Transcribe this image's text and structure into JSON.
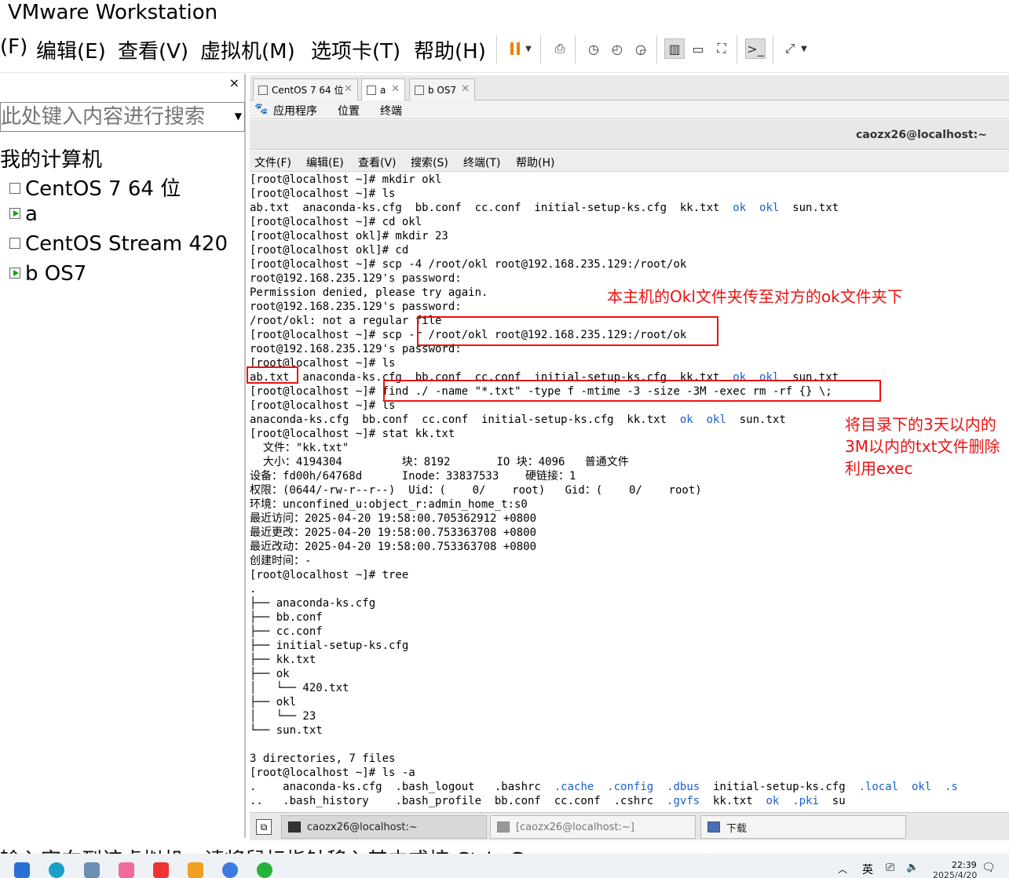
{
  "app_title": "VMware Workstation",
  "menu": [
    "(F)",
    "编辑(E)",
    "查看(V)",
    "虚拟机(M)",
    "选项卡(T)",
    "帮助(H)"
  ],
  "library": {
    "close": "×",
    "search_placeholder": "此处键入内容进行搜索",
    "root": "我的计算机",
    "vms": [
      "CentOS 7 64 位",
      "a",
      "CentOS Stream 420",
      "b OS7"
    ]
  },
  "vm_tabs": [
    {
      "label": "CentOS 7 64 位",
      "active": false
    },
    {
      "label": "a",
      "active": true
    },
    {
      "label": "b OS7",
      "active": false
    }
  ],
  "gnome_panel": [
    "应用程序",
    "位置",
    "终端"
  ],
  "terminal_window_title": "caozx26@localhost:~",
  "terminal_menu": [
    "文件(F)",
    "编辑(E)",
    "查看(V)",
    "搜索(S)",
    "终端(T)",
    "帮助(H)"
  ],
  "terminal_lines": [
    "[root@localhost ~]# mkdir okl",
    "[root@localhost ~]# ls",
    "ab.txt  anaconda-ks.cfg  bb.conf  cc.conf  initial-setup-ks.cfg  kk.txt  ",
    "[root@localhost ~]# cd okl",
    "[root@localhost okl]# mkdir 23",
    "[root@localhost okl]# cd",
    "[root@localhost ~]# scp -4 /root/okl root@192.168.235.129:/root/ok",
    "root@192.168.235.129's password:",
    "Permission denied, please try again.",
    "root@192.168.235.129's password:",
    "/root/okl: not a regular file",
    "[root@localhost ~]# scp -r /root/okl root@192.168.235.129:/root/ok",
    "root@192.168.235.129's password:",
    "[root@localhost ~]# ls",
    "ab.txt  anaconda-ks.cfg  bb.conf  cc.conf  initial-setup-ks.cfg  kk.txt  ",
    "[root@localhost ~]# find ./ -name \"*.txt\" -type f -mtime -3 -size -3M -exec rm -rf {} \\;",
    "[root@localhost ~]# ls",
    "anaconda-ks.cfg  bb.conf  cc.conf  initial-setup-ks.cfg  kk.txt  ",
    "[root@localhost ~]# stat kk.txt",
    "  文件：\"kk.txt\"",
    "  大小：4194304         块：8192       IO 块：4096   普通文件",
    "设备：fd00h/64768d      Inode：33837533    硬链接：1",
    "权限：(0644/-rw-r--r--)  Uid：(    0/    root)   Gid：(    0/    root)",
    "环境：unconfined_u:object_r:admin_home_t:s0",
    "最近访问：2025-04-20 19:58:00.705362912 +0800",
    "最近更改：2025-04-20 19:58:00.753363708 +0800",
    "最近改动：2025-04-20 19:58:00.753363708 +0800",
    "创建时间：-",
    "[root@localhost ~]# tree",
    ".",
    "├── anaconda-ks.cfg",
    "├── bb.conf",
    "├── cc.conf",
    "├── initial-setup-ks.cfg",
    "├── kk.txt",
    "├── ok",
    "│   └── 420.txt",
    "├── okl",
    "│   └── 23",
    "└── sun.txt",
    "",
    "3 directories, 7 files",
    "[root@localhost ~]# ls -a",
    ".    anaconda-ks.cfg  .bash_logout   .bashrc  ",
    "..   .bash_history    .bash_profile  bb.conf  cc.conf  "
  ],
  "ls_blue_dirs": {
    "ok": "ok",
    "okl": "okl",
    "sun": "sun.txt"
  },
  "ls_a_line1_tail": {
    "cache": ".cache",
    "config": ".config",
    "dbus": ".dbus",
    "initial": "initial-setup-ks.cfg",
    "local": ".local",
    "okl": "okl",
    "s": ".s"
  },
  "ls_a_line2_tail": {
    "cshrc": ".cshrc",
    "gvfs": ".gvfs",
    "kk": "kk.txt",
    "ok": "ok",
    "pki": ".pki",
    "su": "su"
  },
  "annotations": {
    "scp_note": "本主机的Okl文件夹传至对方的ok文件夹下",
    "find_note": [
      "将目录下的3天以内的",
      "3M以内的txt文件删除",
      "利用exec"
    ]
  },
  "vm_taskbar": [
    {
      "label": "caozx26@localhost:~",
      "active": true
    },
    {
      "label": "[caozx26@localhost:~]",
      "active": false
    },
    {
      "label": "下载",
      "active": false
    }
  ],
  "status_hint": "输入定向到该虚拟机，请将鼠标指针移入其中或按 Ctrl+G。",
  "windows_tray": {
    "lang": "英",
    "time": "22:39",
    "date": "2025/4/20"
  },
  "colors": {
    "annotation": "#e11111",
    "dir_blue": "#1a5fd1",
    "pause": "#f08000"
  }
}
